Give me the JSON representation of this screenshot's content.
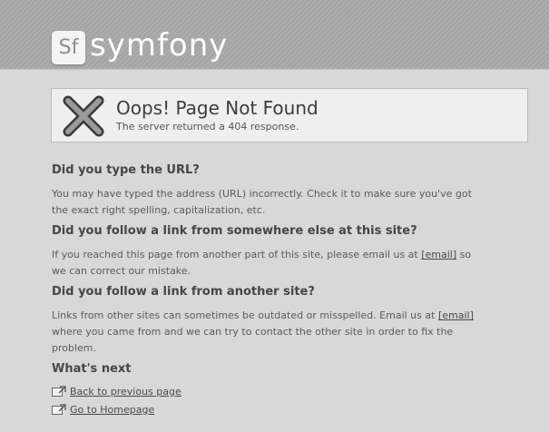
{
  "header": {
    "logo_badge": "Sf",
    "logo_word": "symfony"
  },
  "error": {
    "icon": "x-cross-icon",
    "title": "Oops! Page Not Found",
    "subtitle": "The server returned a 404 response."
  },
  "sections": [
    {
      "heading": "Did you type the URL?",
      "text": "You may have typed the address (URL) incorrectly. Check it to make sure you've got the exact right spelling, capitalization, etc."
    },
    {
      "heading": "Did you follow a link from somewhere else at this site?",
      "text_before": "If you reached this page from another part of this site, please email us at",
      "link": "[email]",
      "text_after": "so we can correct our mistake."
    },
    {
      "heading": "Did you follow a link from another site?",
      "text_before": "Links from other sites can sometimes be outdated or misspelled. Email us at",
      "link": "[email]",
      "text_after": "where you came from and we can try to contact the other site in order to fix the problem."
    }
  ],
  "whats_next": {
    "heading": "What's next",
    "links": [
      {
        "label": "Back to previous page",
        "icon": "back-arrow-icon"
      },
      {
        "label": "Go to Homepage",
        "icon": "home-arrow-icon"
      }
    ]
  },
  "colors": {
    "background": "#d8d8d8",
    "header": "#a8a8a8",
    "box": "#efefef"
  }
}
